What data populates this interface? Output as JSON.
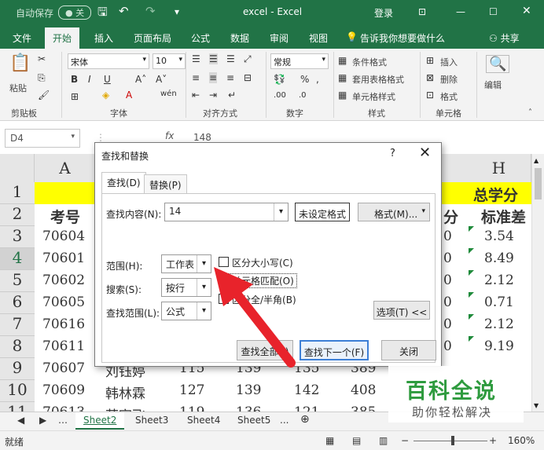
{
  "titlebar": {
    "autosave": "自动保存",
    "autosave_state": "关",
    "title": "excel  -  Excel",
    "login": "登录"
  },
  "tabs": [
    "文件",
    "开始",
    "插入",
    "页面布局",
    "公式",
    "数据",
    "审阅",
    "视图"
  ],
  "tell_me": "告诉我你想要做什么",
  "share": "共享",
  "ribbon": {
    "paste": "粘贴",
    "font_name": "宋体",
    "font_size": "10",
    "number_format": "常规",
    "cond_format": "条件格式",
    "table_format": "套用表格格式",
    "cell_style": "单元格样式",
    "insert": "插入",
    "delete": "删除",
    "format": "格式",
    "edit": "编辑",
    "groups": [
      "剪贴板",
      "字体",
      "对齐方式",
      "数字",
      "样式",
      "单元格"
    ]
  },
  "formula_bar": {
    "name_box": "D4",
    "fx": "fx",
    "value": "148"
  },
  "grid": {
    "columns": [
      "A",
      "H"
    ],
    "rows": [
      "1",
      "2",
      "3",
      "4",
      "5",
      "6",
      "7",
      "8",
      "9",
      "10",
      "11"
    ],
    "header_a": "考号",
    "header_h1": "总学分",
    "header_h2": "标准差",
    "col_a": [
      "70604",
      "70601",
      "70602",
      "70605",
      "70616",
      "70611",
      "70607",
      "70609",
      "70613"
    ],
    "col_h": [
      "3.54",
      "8.49",
      "2.12",
      "0.71",
      "2.12",
      "9.19"
    ],
    "row9": [
      "刘钰婷",
      "115",
      "139",
      "135",
      "389"
    ],
    "row10": [
      "韩林霖",
      "127",
      "139",
      "142",
      "408"
    ],
    "row11": [
      "苏宇飞",
      "119",
      "136",
      "121",
      "385"
    ],
    "partial_fen": "分",
    "partial_zero": "0"
  },
  "dialog": {
    "title": "查找和替换",
    "help": "?",
    "close": "✕",
    "tab_find": "查找(D)",
    "tab_replace": "替换(P)",
    "find_label": "查找内容(N):",
    "find_value": "14",
    "no_format": "未设定格式",
    "format_btn": "格式(M)...",
    "scope_label": "范围(H):",
    "scope_value": "工作表",
    "search_label": "搜索(S):",
    "search_value": "按行",
    "lookin_label": "查找范围(L):",
    "lookin_value": "公式",
    "match_case": "区分大小写(C)",
    "match_cell": "单元格匹配(O)",
    "match_byte": "区分全/半角(B)",
    "options_btn": "选项(T) <<",
    "find_all": "查找全部(I)",
    "find_next": "查找下一个(F)",
    "close_btn": "关闭",
    "match_cell_checked": true
  },
  "sheets": [
    "Sheet2",
    "Sheet3",
    "Sheet4",
    "Sheet5",
    "..."
  ],
  "status": {
    "ready": "就绪",
    "zoom": "160%"
  },
  "watermark": {
    "main": "百科全说",
    "sub": "助你轻松解决"
  },
  "colors": {
    "excel_green": "#217346",
    "header_yellow": "#ffff00",
    "arrow_red": "#e8232b"
  }
}
